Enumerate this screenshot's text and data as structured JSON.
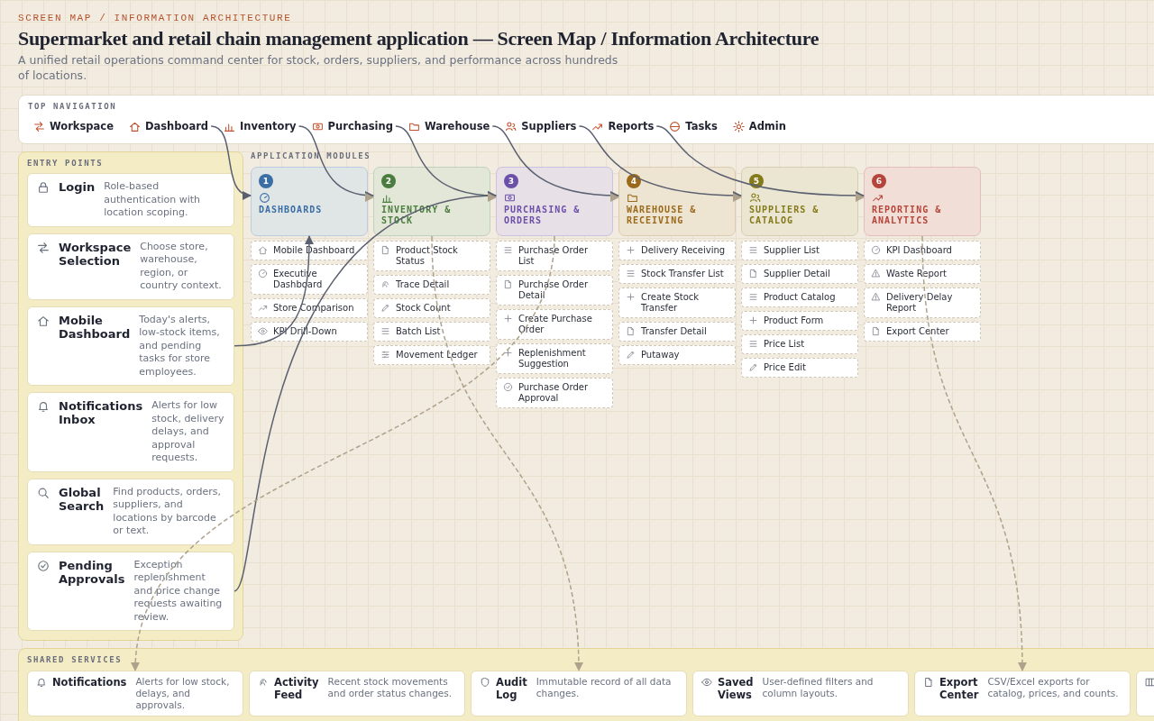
{
  "header": {
    "eyebrow": "SCREEN MAP / INFORMATION ARCHITECTURE",
    "title": "Supermarket and retail chain management application — Screen Map / Information Architecture",
    "subtitle": "A unified retail operations command center for stock, orders, suppliers, and performance across hundreds of locations."
  },
  "top_navigation": {
    "label": "TOP NAVIGATION",
    "items": [
      {
        "label": "Workspace"
      },
      {
        "label": "Dashboard"
      },
      {
        "label": "Inventory"
      },
      {
        "label": "Purchasing"
      },
      {
        "label": "Warehouse"
      },
      {
        "label": "Suppliers"
      },
      {
        "label": "Reports"
      },
      {
        "label": "Tasks"
      },
      {
        "label": "Admin"
      }
    ]
  },
  "entry_points": {
    "label": "ENTRY POINTS",
    "items": [
      {
        "title": "Login",
        "description": "Role-based authentication with location scoping."
      },
      {
        "title": "Workspace Selection",
        "description": "Choose store, warehouse, region, or country context."
      },
      {
        "title": "Mobile Dashboard",
        "description": "Today's alerts, low-stock items, and pending tasks for store employees."
      },
      {
        "title": "Notifications Inbox",
        "description": "Alerts for low stock, delivery delays, and approval requests."
      },
      {
        "title": "Global Search",
        "description": "Find products, orders, suppliers, and locations by barcode or text."
      },
      {
        "title": "Pending Approvals",
        "description": "Exception replenishment and price change requests awaiting review."
      }
    ]
  },
  "modules": {
    "label": "APPLICATION MODULES",
    "items": [
      {
        "number": "1",
        "title": "DASHBOARDS",
        "color": "#3a6ea5",
        "screens": [
          {
            "label": "Mobile Dashboard",
            "kind": "home"
          },
          {
            "label": "Executive Dashboard",
            "kind": "gauge"
          },
          {
            "label": "Store Comparison",
            "kind": "trend"
          },
          {
            "label": "KPI Drill-Down",
            "kind": "eye"
          }
        ]
      },
      {
        "number": "2",
        "title": "INVENTORY & STOCK",
        "color": "#4a7c3f",
        "screens": [
          {
            "label": "Product Stock Status",
            "kind": "detail"
          },
          {
            "label": "Trace Detail",
            "kind": "trace"
          },
          {
            "label": "Stock Count",
            "kind": "edit"
          },
          {
            "label": "Batch List",
            "kind": "list"
          },
          {
            "label": "Movement Ledger",
            "kind": "ledger"
          }
        ]
      },
      {
        "number": "3",
        "title": "PURCHASING & ORDERS",
        "color": "#6b4fa8",
        "screens": [
          {
            "label": "Purchase Order List",
            "kind": "list"
          },
          {
            "label": "Purchase Order Detail",
            "kind": "detail"
          },
          {
            "label": "Create Purchase Order",
            "kind": "create"
          },
          {
            "label": "Replenishment Suggestion",
            "kind": "create"
          },
          {
            "label": "Purchase Order Approval",
            "kind": "approval"
          }
        ]
      },
      {
        "number": "4",
        "title": "WAREHOUSE & RECEIVING",
        "color": "#9a6a1a",
        "screens": [
          {
            "label": "Delivery Receiving",
            "kind": "create"
          },
          {
            "label": "Stock Transfer List",
            "kind": "list"
          },
          {
            "label": "Create Stock Transfer",
            "kind": "create"
          },
          {
            "label": "Transfer Detail",
            "kind": "detail"
          },
          {
            "label": "Putaway",
            "kind": "edit"
          }
        ]
      },
      {
        "number": "5",
        "title": "SUPPLIERS & CATALOG",
        "color": "#857a1a",
        "screens": [
          {
            "label": "Supplier List",
            "kind": "list"
          },
          {
            "label": "Supplier Detail",
            "kind": "detail"
          },
          {
            "label": "Product Catalog",
            "kind": "list"
          },
          {
            "label": "Product Form",
            "kind": "create"
          },
          {
            "label": "Price List",
            "kind": "list"
          },
          {
            "label": "Price Edit",
            "kind": "edit"
          }
        ]
      },
      {
        "number": "6",
        "title": "REPORTING & ANALYTICS",
        "color": "#b5443a",
        "screens": [
          {
            "label": "KPI Dashboard",
            "kind": "gauge"
          },
          {
            "label": "Waste Report",
            "kind": "alert"
          },
          {
            "label": "Delivery Delay Report",
            "kind": "alert"
          },
          {
            "label": "Export Center",
            "kind": "detail"
          }
        ]
      }
    ]
  },
  "shared_services": {
    "label": "SHARED SERVICES",
    "items": [
      {
        "title": "Notifications",
        "description": "Alerts for low stock, delays, and approvals."
      },
      {
        "title": "Activity Feed",
        "description": "Recent stock movements and order status changes."
      },
      {
        "title": "Audit Log",
        "description": "Immutable record of all data changes."
      },
      {
        "title": "Saved Views",
        "description": "User-defined filters and column layouts."
      },
      {
        "title": "Export Center",
        "description": "CSV/Excel exports for catalog, prices, and counts."
      }
    ]
  }
}
